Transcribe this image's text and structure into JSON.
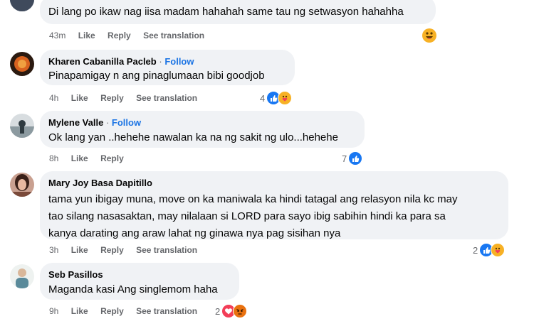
{
  "comments": [
    {
      "text": "Di lang po ikaw nag iisa madam hahahah same tau ng setwasyon hahahha",
      "time": "43m",
      "like": "Like",
      "reply": "Reply",
      "see_translation": "See translation"
    },
    {
      "name": "Kharen Cabanilla Pacleb",
      "follow": "Follow",
      "text": "Pinapamigay n ang pinaglumaan bibi goodjob",
      "time": "4h",
      "like": "Like",
      "reply": "Reply",
      "see_translation": "See translation",
      "reaction_count": "4"
    },
    {
      "name": "Mylene Valle",
      "follow": "Follow",
      "text": "Ok lang yan ..hehehe nawalan ka na ng sakit ng ulo...hehehe",
      "time": "8h",
      "like": "Like",
      "reply": "Reply",
      "reaction_count": "7"
    },
    {
      "name": "Mary Joy Basa Dapitillo",
      "text_lines": [
        "tama yun ibigay muna, move on ka maniwala ka hindi tatagal ang relasyon nila kc may",
        "tao silang nasasaktan, may nilalaan si LORD para sayo ibig sabihin hindi ka para sa",
        "kanya darating ang araw lahat ng ginawa nya pag sisihan nya"
      ],
      "time": "3h",
      "like": "Like",
      "reply": "Reply",
      "see_translation": "See translation",
      "reaction_count": "2"
    },
    {
      "name": "Seb Pasillos",
      "text": "Maganda kasi Ang singlemom haha",
      "time": "9h",
      "like": "Like",
      "reply": "Reply",
      "see_translation": "See translation",
      "reaction_count": "2"
    }
  ],
  "colors": {
    "bubble": "#f0f2f5",
    "link_blue": "#1b74e4",
    "meta_gray": "#65676b",
    "like_blue": "#1877f2",
    "love_red": "#f33e58",
    "care_yellow": "#f7b125"
  }
}
